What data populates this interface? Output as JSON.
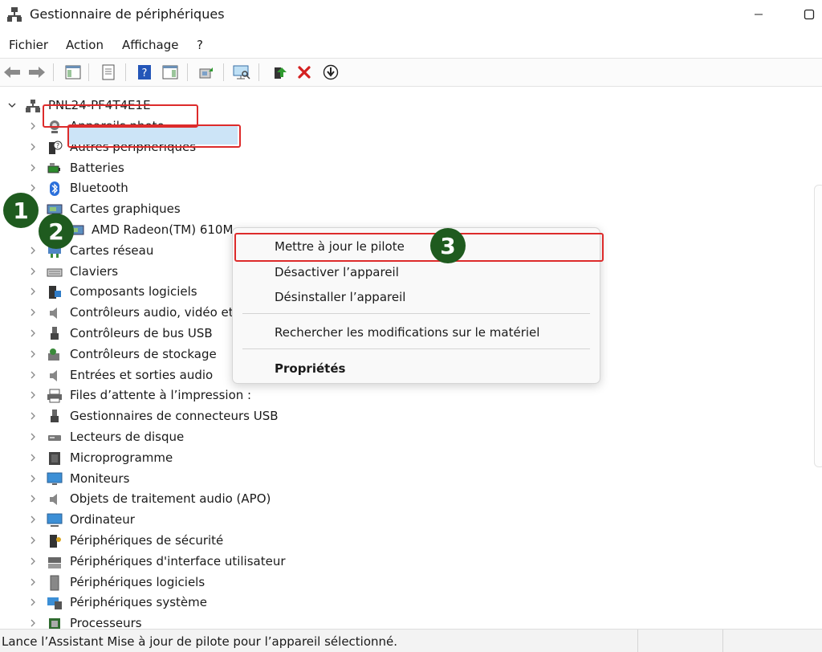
{
  "window": {
    "title": "Gestionnaire de périphériques"
  },
  "menu": [
    "Fichier",
    "Action",
    "Affichage",
    "?"
  ],
  "tree": {
    "root": "PNL24-PF4T4E1E",
    "items": [
      {
        "label": "Appareils photo",
        "icon": "camera-icon"
      },
      {
        "label": "Autres périphériques",
        "icon": "unknown-device-icon"
      },
      {
        "label": "Batteries",
        "icon": "battery-icon"
      },
      {
        "label": "Bluetooth",
        "icon": "bluetooth-icon"
      },
      {
        "label": "Cartes graphiques",
        "icon": "display-adapter-icon",
        "expanded": true
      },
      {
        "label": "AMD Radeon(TM) 610M",
        "icon": "display-adapter-icon",
        "child": true
      },
      {
        "label": "Cartes réseau",
        "icon": "network-icon"
      },
      {
        "label": "Claviers",
        "icon": "keyboard-icon"
      },
      {
        "label": "Composants logiciels",
        "icon": "software-component-icon"
      },
      {
        "label": "Contrôleurs audio, vidéo et jeu",
        "icon": "speaker-icon"
      },
      {
        "label": "Contrôleurs de bus USB",
        "icon": "usb-icon"
      },
      {
        "label": "Contrôleurs de stockage",
        "icon": "storage-controller-icon"
      },
      {
        "label": "Entrées et sorties audio",
        "icon": "speaker-icon"
      },
      {
        "label": "Files d’attente à l’impression :",
        "icon": "printer-icon"
      },
      {
        "label": "Gestionnaires de connecteurs USB",
        "icon": "usb-icon"
      },
      {
        "label": "Lecteurs de disque",
        "icon": "disk-drive-icon"
      },
      {
        "label": "Microprogramme",
        "icon": "firmware-icon"
      },
      {
        "label": "Moniteurs",
        "icon": "monitor-icon"
      },
      {
        "label": "Objets de traitement audio (APO)",
        "icon": "speaker-icon"
      },
      {
        "label": "Ordinateur",
        "icon": "computer-icon"
      },
      {
        "label": "Périphériques de sécurité",
        "icon": "security-device-icon"
      },
      {
        "label": "Périphériques d'interface utilisateur",
        "icon": "hid-icon"
      },
      {
        "label": "Périphériques logiciels",
        "icon": "software-device-icon"
      },
      {
        "label": "Périphériques système",
        "icon": "system-device-icon"
      },
      {
        "label": "Processeurs",
        "icon": "processor-icon"
      }
    ]
  },
  "context_menu": {
    "items": [
      {
        "label": "Mettre à jour le pilote",
        "bold": false
      },
      {
        "label": "Désactiver l’appareil",
        "bold": false
      },
      {
        "label": "Désinstaller l’appareil",
        "bold": false
      },
      {
        "label": "Rechercher les modifications sur le matériel",
        "bold": false
      },
      {
        "label": "Propriétés",
        "bold": true
      }
    ]
  },
  "badges": [
    "1",
    "2",
    "3"
  ],
  "status": {
    "text": "Lance l’Assistant Mise à jour de pilote pour l’appareil sélectionné."
  },
  "colors": {
    "highlight": "#dd2b2b",
    "badge": "#1f5b1f",
    "selection": "#cce4f7"
  }
}
